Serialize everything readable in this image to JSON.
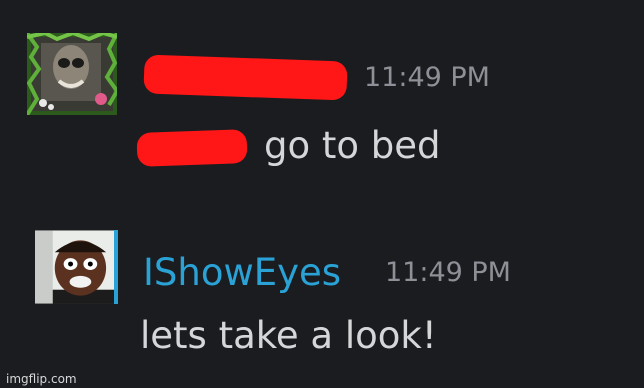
{
  "messages": [
    {
      "author": "",
      "author_redacted": true,
      "time": "11:49 PM",
      "text": "go to bed",
      "mention_redacted": true,
      "avatar_icon": "monkey-meme-avatar-icon"
    },
    {
      "author": "IShowEyes",
      "author_color": "#2aa2d6",
      "time": "11:49 PM",
      "text": "lets take a look!",
      "avatar_icon": "streamer-face-avatar-icon"
    }
  ],
  "watermark": "imgflip.com",
  "colors": {
    "background": "#1b1c20",
    "text": "#d5d6d8",
    "timestamp": "#8d9096",
    "redaction": "#ff1616"
  }
}
